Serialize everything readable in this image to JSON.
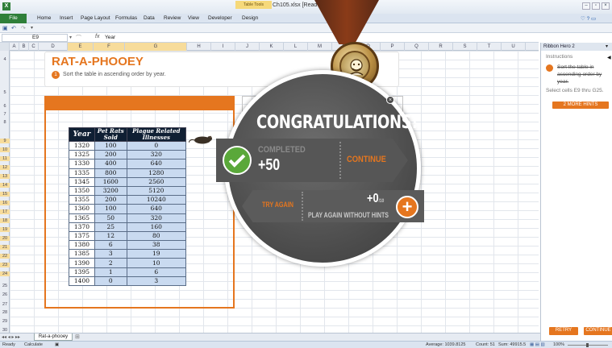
{
  "window": {
    "doc_title": "Ch105.xlsx [Read-Only]",
    "context_tab_group": "Table Tools"
  },
  "ribbon": {
    "file": "File",
    "tabs": [
      "Home",
      "Insert",
      "Page Layout",
      "Formulas",
      "Data",
      "Review",
      "View",
      "Developer",
      "Design"
    ]
  },
  "formula_bar": {
    "name_box": "E9",
    "fx": "fx",
    "value": "Year"
  },
  "columns": [
    "A",
    "B",
    "C",
    "D",
    "E",
    "F",
    "G",
    "H",
    "I",
    "J",
    "K",
    "L",
    "M",
    "N",
    "O",
    "P",
    "Q",
    "R",
    "S",
    "T",
    "U"
  ],
  "rows": [
    "4",
    "5",
    "6",
    "7",
    "8",
    "9",
    "10",
    "11",
    "12",
    "13",
    "14",
    "15",
    "16",
    "17",
    "18",
    "19",
    "20",
    "21",
    "22",
    "23",
    "24",
    "25",
    "26",
    "27",
    "28",
    "29",
    "30"
  ],
  "puzzle": {
    "title": "RAT-A-PHOOEY",
    "step": "1",
    "instruction": "Sort the table in ascending order by year."
  },
  "table": {
    "headers": [
      "Year",
      "Pet Rats Sold",
      "Plague Related Illnesses"
    ],
    "rows": [
      [
        "1320",
        "100",
        "0"
      ],
      [
        "1325",
        "200",
        "320"
      ],
      [
        "1330",
        "400",
        "640"
      ],
      [
        "1335",
        "800",
        "1280"
      ],
      [
        "1345",
        "1600",
        "2560"
      ],
      [
        "1350",
        "3200",
        "5120"
      ],
      [
        "1355",
        "200",
        "10240"
      ],
      [
        "1360",
        "100",
        "640"
      ],
      [
        "1365",
        "50",
        "320"
      ],
      [
        "1370",
        "25",
        "160"
      ],
      [
        "1375",
        "12",
        "80"
      ],
      [
        "1380",
        "6",
        "38"
      ],
      [
        "1385",
        "3",
        "19"
      ],
      [
        "1390",
        "2",
        "10"
      ],
      [
        "1395",
        "1",
        "6"
      ],
      [
        "1400",
        "0",
        "3"
      ]
    ]
  },
  "dialog": {
    "title": "CONGRATULATIONS!",
    "completed_label": "COMPLETED",
    "points": "+50",
    "continue": "CONTINUE",
    "try_again": "TRY AGAIN",
    "plus_points": "+0",
    "plus_points_sub": "/10",
    "play_again": "PLAY AGAIN WITHOUT HINTS",
    "plus_glyph": "+",
    "close_glyph": "×"
  },
  "pane": {
    "title": "Ribbon Hero 2",
    "instructions_label": "Instructions",
    "done_step": "Sort the table in ascending order by year.",
    "hint": "Select cells E9 thru G25.",
    "more_hints": "2 MORE HINTS",
    "retry": "RETRY",
    "continue": "CONTINUE"
  },
  "sheet_tab": "Rat-a-phooey",
  "status": {
    "ready": "Ready",
    "calculate": "Calculate",
    "average": "Average: 1039.8125",
    "count": "Count: 51",
    "sum": "Sum: 49915.5",
    "zoom": "100%"
  }
}
